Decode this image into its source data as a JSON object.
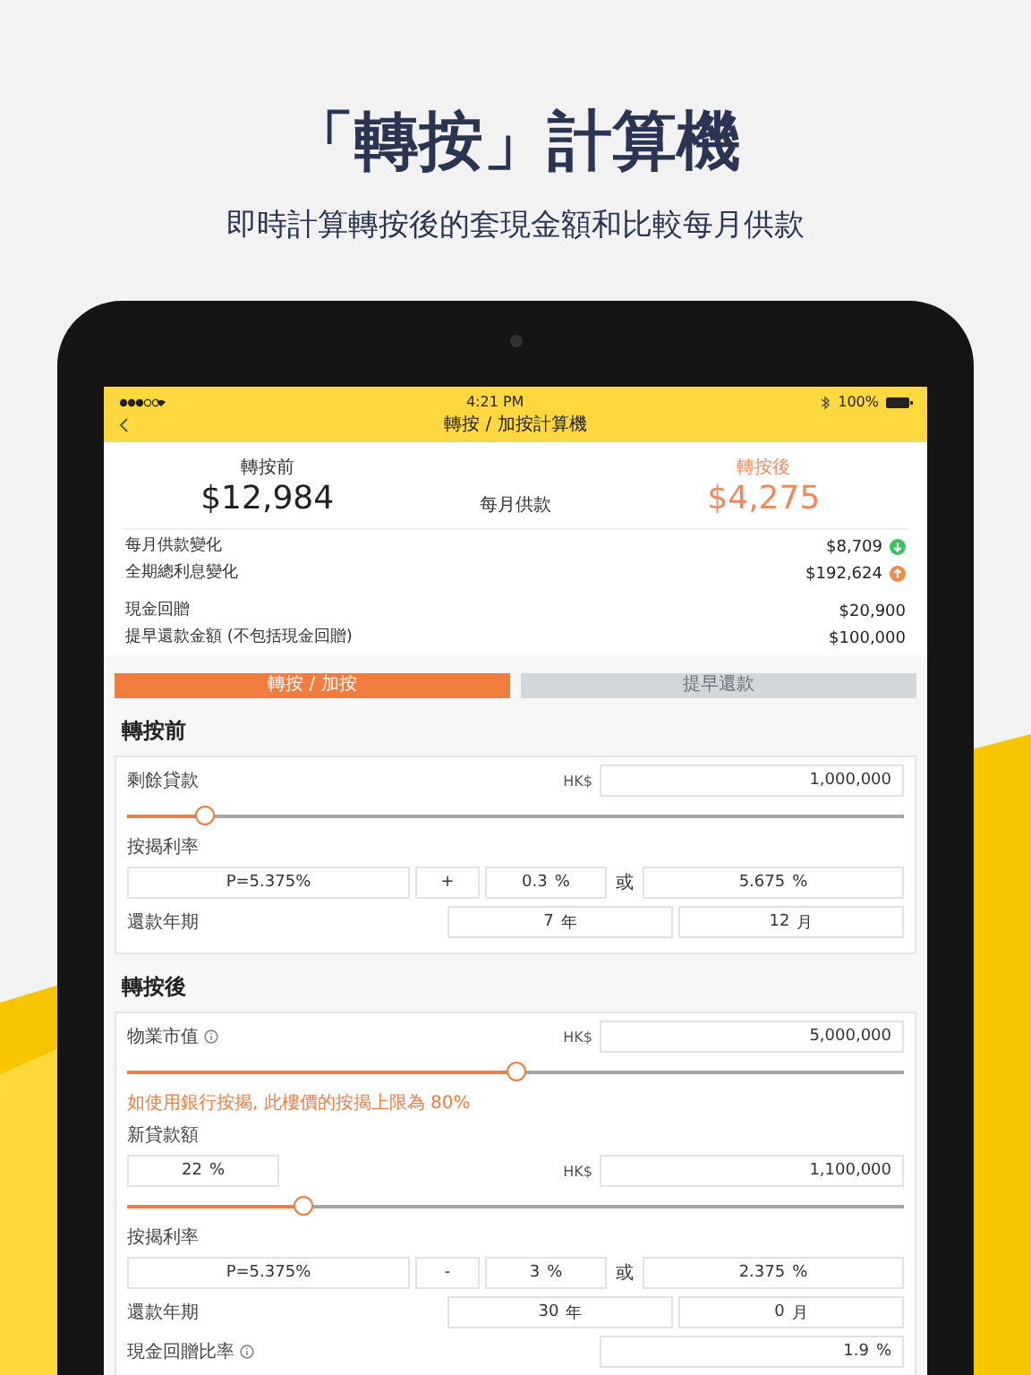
{
  "headline": {
    "title": "「轉按」計算機",
    "subtitle": "即時計算轉按後的套現金額和比較每月供款"
  },
  "status_bar": {
    "time": "4:21 PM",
    "battery": "100%"
  },
  "nav": {
    "title": "轉按 / 加按計算機"
  },
  "summary": {
    "before_label": "轉按前",
    "before_value": "$12,984",
    "middle_label": "每月供款",
    "after_label": "轉按後",
    "after_value": "$4,275"
  },
  "changes": [
    {
      "label": "每月供款變化",
      "value": "$8,709",
      "kind": "down"
    },
    {
      "label": "全期總利息變化",
      "value": "$192,624",
      "kind": "up"
    }
  ],
  "amounts": [
    {
      "label": "現金回贈",
      "value": "$20,900"
    },
    {
      "label": "提早還款金額 (不包括現金回贈)",
      "value": "$100,000"
    }
  ],
  "tabs": [
    {
      "label": "轉按 / 加按",
      "selected": true
    },
    {
      "label": "提早還款",
      "selected": false
    }
  ],
  "sections": [
    {
      "title": "轉按前",
      "rows": [
        {
          "kind": "amount",
          "label": "剩餘貸款",
          "info": false,
          "currency": "HK$",
          "value": "1,000,000"
        },
        {
          "kind": "slider",
          "level": 0.1
        },
        {
          "kind": "label",
          "text": "按揭利率"
        },
        {
          "kind": "rate",
          "prime": "P=5.375%",
          "sign": "+",
          "spread": "0.3",
          "spread_unit": "%",
          "or": "或",
          "total": "5.675",
          "total_unit": "%"
        },
        {
          "kind": "term",
          "label": "還款年期",
          "years": "7",
          "year_unit": "年",
          "months": "12",
          "month_unit": "月"
        }
      ]
    },
    {
      "title": "轉按後",
      "rows": [
        {
          "kind": "amount",
          "label": "物業市值",
          "info": true,
          "currency": "HK$",
          "value": "5,000,000"
        },
        {
          "kind": "slider",
          "level": 0.5
        },
        {
          "kind": "note",
          "text": "如使用銀行按揭, 此樓價的按揭上限為 80%"
        },
        {
          "kind": "label",
          "text": "新貸款額"
        },
        {
          "kind": "percent_amount",
          "percent": "22",
          "unit": "%",
          "currency": "HK$",
          "value": "1,100,000"
        },
        {
          "kind": "slider",
          "level": 0.225
        },
        {
          "kind": "label",
          "text": "按揭利率"
        },
        {
          "kind": "rate",
          "prime": "P=5.375%",
          "sign": "-",
          "spread": "3",
          "spread_unit": "%",
          "or": "或",
          "total": "2.375",
          "total_unit": "%"
        },
        {
          "kind": "term",
          "label": "還款年期",
          "years": "30",
          "year_unit": "年",
          "months": "0",
          "month_unit": "月"
        },
        {
          "kind": "percent",
          "label": "現金回贈比率",
          "info": true,
          "value": "1.9",
          "unit": "%"
        }
      ]
    }
  ]
}
